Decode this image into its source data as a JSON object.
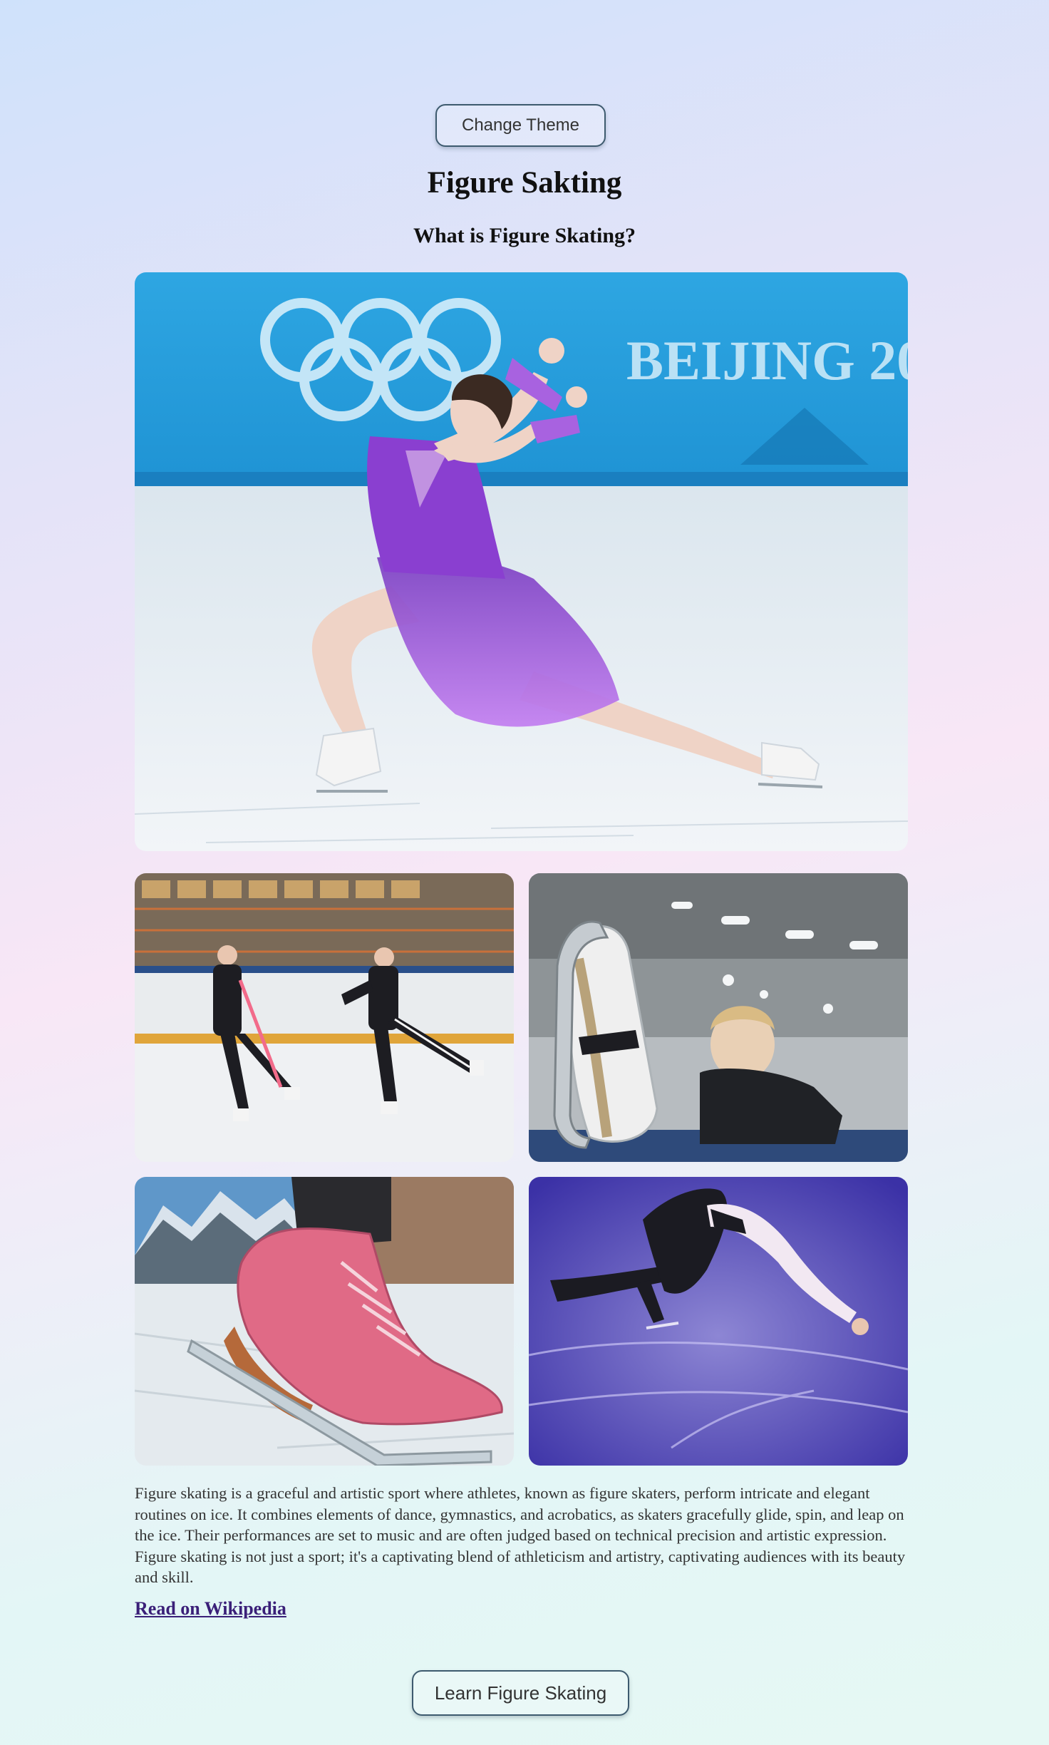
{
  "header": {
    "theme_button_label": "Change Theme",
    "title": "Figure Sakting",
    "subtitle": "What is Figure Skating?"
  },
  "gallery": {
    "hero_banner_text": "BEIJING 20",
    "images": [
      {
        "subject": "skater-spiral-pose"
      },
      {
        "subject": "pair-skaters-practice"
      },
      {
        "subject": "skate-blade-closeup"
      },
      {
        "subject": "pink-skates-mountains"
      },
      {
        "subject": "skater-spin-purple-ice"
      }
    ]
  },
  "content": {
    "description": "Figure skating is a graceful and artistic sport where athletes, known as figure skaters, perform intricate and elegant routines on ice. It combines elements of dance, gymnastics, and acrobatics, as skaters gracefully glide, spin, and leap on the ice. Their performances are set to music and are often judged based on technical precision and artistic expression. Figure skating is not just a sport; it's a captivating blend of athleticism and artistry, captivating audiences with its beauty and skill.",
    "wiki_link_label": "Read on Wikipedia"
  },
  "footer": {
    "learn_button_label": "Learn Figure Skating"
  },
  "colors": {
    "button_border": "#3d5a6e",
    "link": "#3a1f78",
    "ice_blue": "#2aa2df",
    "dress_purple": "#9b4fd6"
  }
}
